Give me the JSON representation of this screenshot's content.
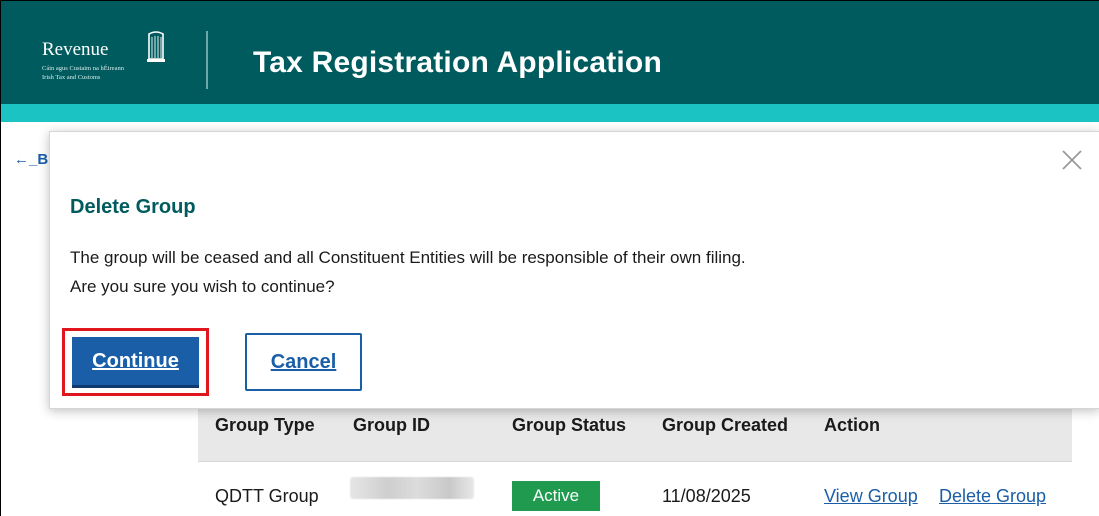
{
  "header": {
    "logo": {
      "wordmark": "Revenue",
      "subtitle_line1": "Cáin agus Custaim na hÉireann",
      "subtitle_line2": "Irish Tax and Customs"
    },
    "title": "Tax Registration Application"
  },
  "page": {
    "back_link": "←_B"
  },
  "modal": {
    "title": "Delete Group",
    "body_line1": "The group will be ceased and all Constituent Entities will be responsible of their own filing.",
    "body_line2": "Are you sure you wish to continue?",
    "continue_label": "Continue",
    "cancel_label": "Cancel",
    "close_icon": "close-x-icon"
  },
  "table": {
    "headers": [
      "Group Type",
      "Group ID",
      "Group Status",
      "Group Created",
      "Action"
    ],
    "rows": [
      {
        "group_type": "QDTT Group",
        "group_id": "",
        "group_status": "Active",
        "group_created": "11/08/2025",
        "actions": [
          "View Group",
          "Delete Group"
        ]
      }
    ]
  },
  "colors": {
    "header_bg": "#005b5e",
    "accent_strip": "#1cc3c3",
    "primary_button": "#1a5ea8",
    "highlight_border": "#e0151d",
    "status_active": "#1f9a4f",
    "modal_title": "#005b5e"
  }
}
